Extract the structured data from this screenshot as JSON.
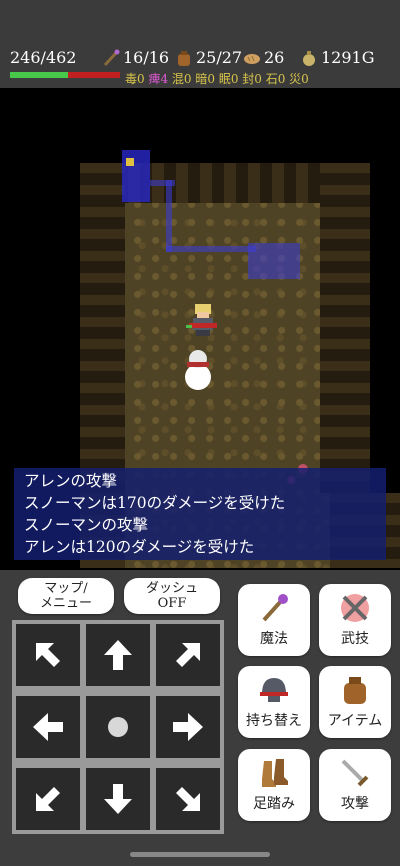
{
  "hud": {
    "hp": "246/462",
    "hp_fraction": 0.53,
    "weapon_uses": "16/16",
    "bag": "25/27",
    "food": "26",
    "gold": "1291G",
    "status_effects": [
      {
        "label": "毒0",
        "color": "#d8c44a"
      },
      {
        "label": "痺4",
        "color": "#e05ad8"
      },
      {
        "label": "混0",
        "color": "#d8c44a"
      },
      {
        "label": "暗0",
        "color": "#d8c44a"
      },
      {
        "label": "眠0",
        "color": "#d8c44a"
      },
      {
        "label": "封0",
        "color": "#d8c44a"
      },
      {
        "label": "石0",
        "color": "#d8c44a"
      },
      {
        "label": "災0",
        "color": "#d8c44a"
      }
    ]
  },
  "message_log": [
    "アレンの攻撃",
    "スノーマンは170のダメージを受けた",
    "スノーマンの攻撃",
    "アレンは120のダメージを受けた"
  ],
  "controls": {
    "map_menu": [
      "マップ/",
      "メニュー"
    ],
    "dash": [
      "ダッシュ",
      "OFF"
    ],
    "actions": {
      "magic": "魔法",
      "skill": "武技",
      "swap": "持ち替え",
      "item": "アイテム",
      "step": "足踏み",
      "attack": "攻撃"
    }
  }
}
